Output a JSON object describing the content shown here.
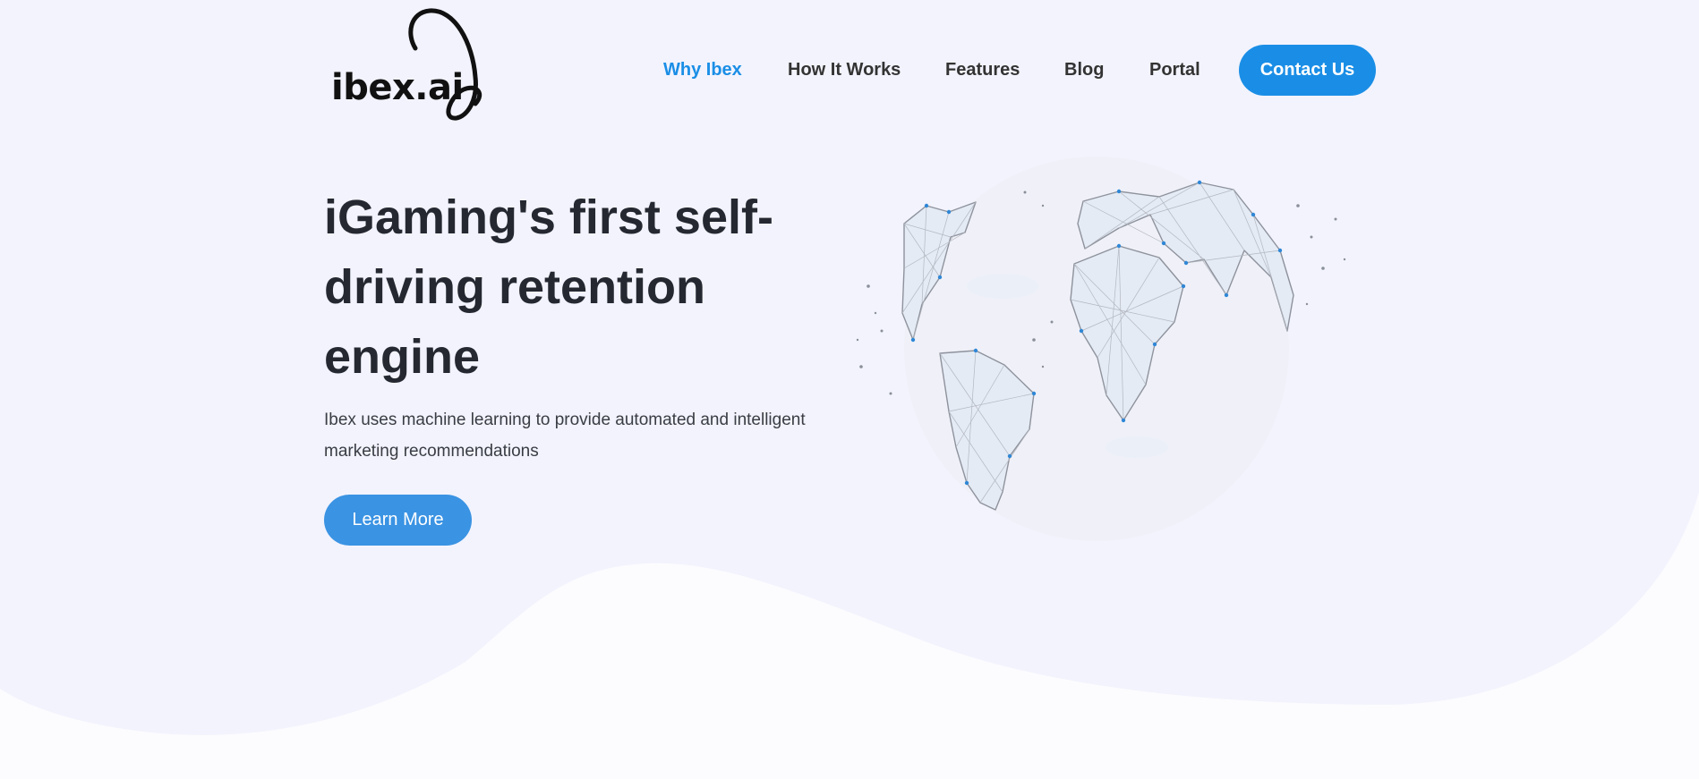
{
  "brand": {
    "name": "ibex.ai",
    "logo_icon": "ibex-horn-swoosh-icon"
  },
  "nav": {
    "items": [
      {
        "label": "Why Ibex",
        "active": true
      },
      {
        "label": "How It Works",
        "active": false
      },
      {
        "label": "Features",
        "active": false
      },
      {
        "label": "Blog",
        "active": false
      },
      {
        "label": "Portal",
        "active": false
      }
    ],
    "cta_label": "Contact Us"
  },
  "hero": {
    "title": "iGaming's first self-driving retention engine",
    "subtitle": "Ibex uses machine learning to provide automated and intelligent marketing recommendations",
    "button_label": "Learn More",
    "illustration": "network-globe-icon"
  },
  "colors": {
    "accent": "#1a8ee6",
    "button": "#3a93e3",
    "hero_background": "#f2f3fd",
    "page_background": "#fcfcfe",
    "heading": "#252830"
  }
}
